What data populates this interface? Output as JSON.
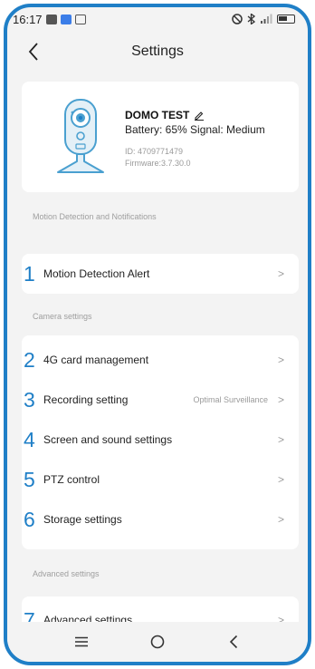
{
  "status_bar": {
    "time": "16:17"
  },
  "header": {
    "title": "Settings"
  },
  "device": {
    "name": "DOMO TEST",
    "status": "Battery:  65% Signal:  Medium",
    "id": "ID:  4709771479",
    "firmware": "Firmware:3.7.30.0"
  },
  "sections": {
    "motion": {
      "header": "Motion Detection and Notifications",
      "items": [
        {
          "num": "1",
          "label": "Motion Detection Alert",
          "value": ""
        }
      ]
    },
    "camera": {
      "header": "Camera settings",
      "items": [
        {
          "num": "2",
          "label": "4G card management",
          "value": ""
        },
        {
          "num": "3",
          "label": "Recording setting",
          "value": "Optimal Surveillance"
        },
        {
          "num": "4",
          "label": "Screen and sound settings",
          "value": ""
        },
        {
          "num": "5",
          "label": "PTZ control",
          "value": ""
        },
        {
          "num": "6",
          "label": "Storage settings",
          "value": ""
        }
      ]
    },
    "advanced": {
      "header": "Advanced settings",
      "items": [
        {
          "num": "7",
          "label": "Advanced settings",
          "value": ""
        }
      ]
    }
  },
  "chevron": ">",
  "icons": {
    "back": "back-arrow-icon",
    "edit": "pencil-icon",
    "nav_menu": "menu-icon",
    "nav_home": "home-circle-icon",
    "nav_back": "back-triangle-icon"
  },
  "colors": {
    "accent": "#1f7fc7",
    "background": "#f3f3f3",
    "card": "#ffffff"
  }
}
